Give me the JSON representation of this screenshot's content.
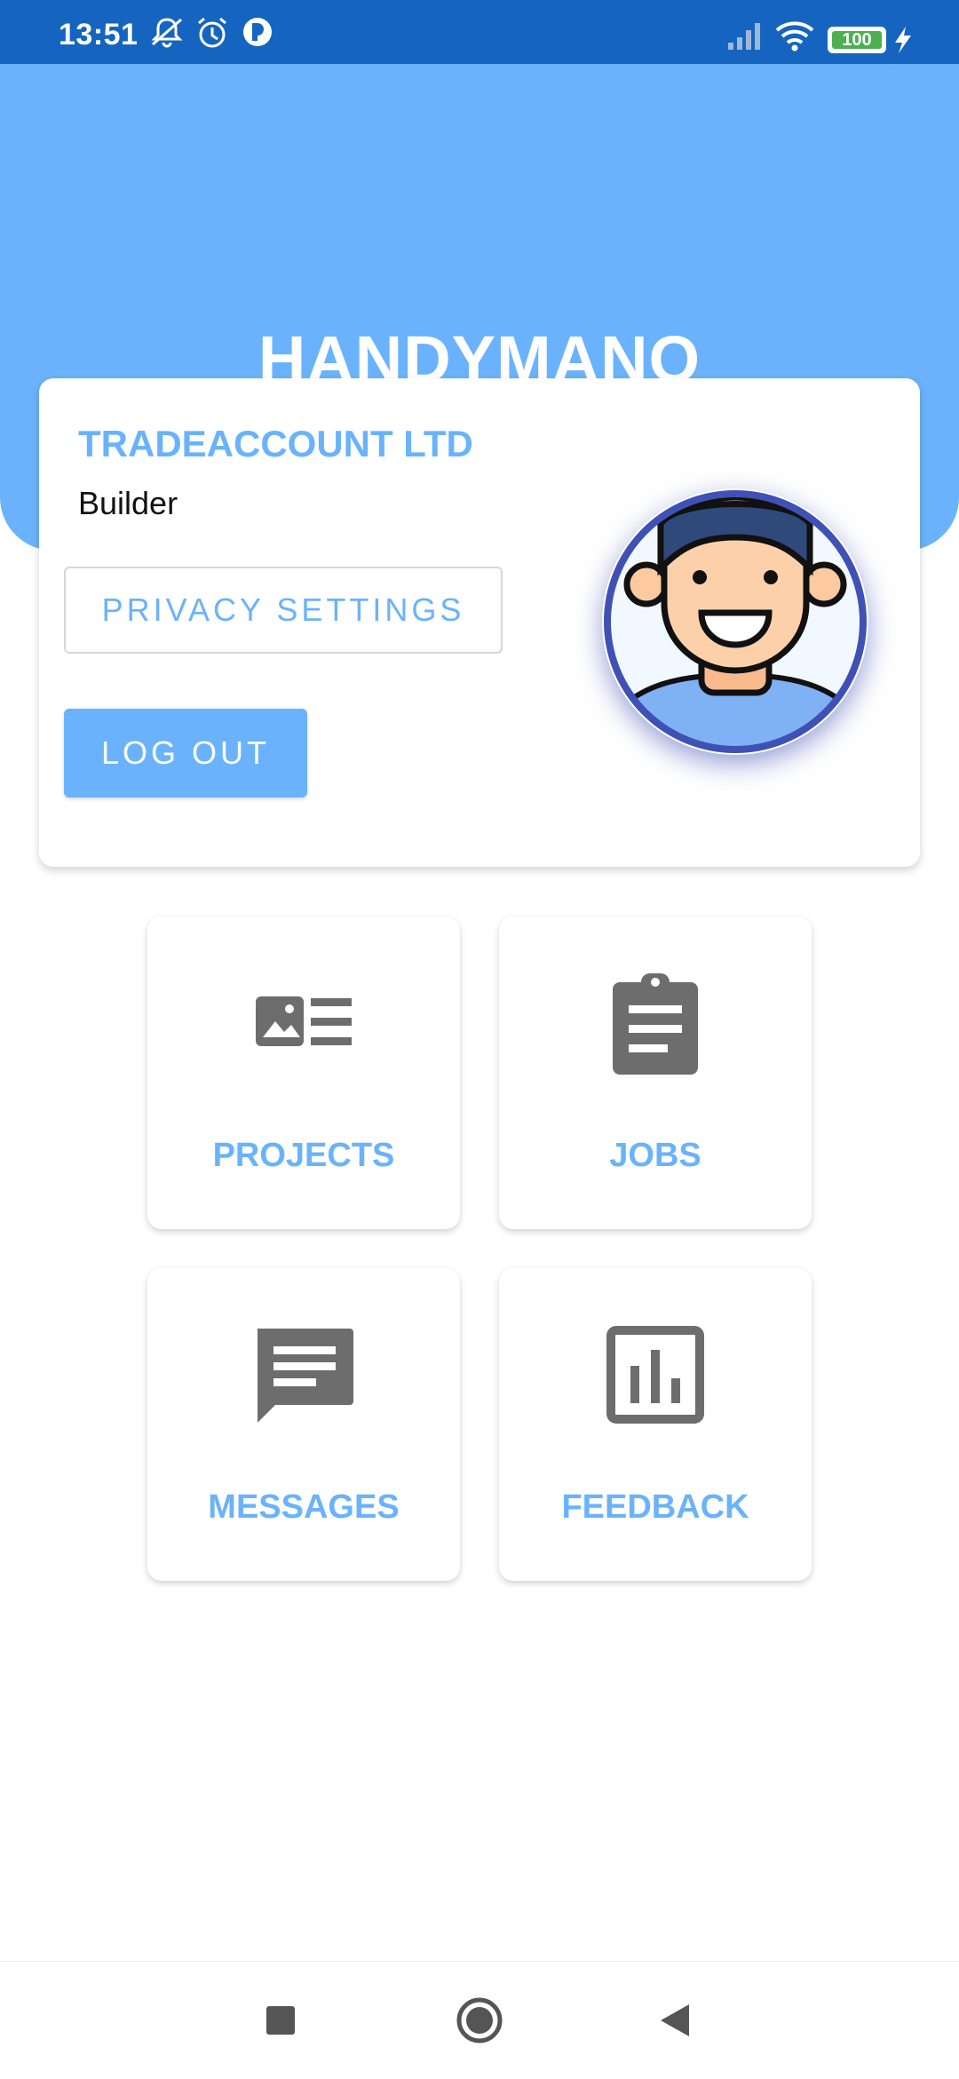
{
  "status_bar": {
    "time": "13:51",
    "battery": "100",
    "icons": [
      "notifications-off-icon",
      "alarm-icon",
      "app-icon",
      "signal-icon",
      "wifi-icon",
      "battery-icon",
      "charging-icon"
    ]
  },
  "header": {
    "title": "HANDYMANO"
  },
  "profile": {
    "company": "TRADEACCOUNT LTD",
    "role": "Builder",
    "privacy_label": "PRIVACY SETTINGS",
    "logout_label": "LOG OUT",
    "avatar_icon": "user-avatar-icon"
  },
  "tiles": [
    {
      "label": "PROJECTS",
      "icon": "projects-icon"
    },
    {
      "label": "JOBS",
      "icon": "clipboard-icon"
    },
    {
      "label": "MESSAGES",
      "icon": "message-icon"
    },
    {
      "label": "FEEDBACK",
      "icon": "bar-chart-icon"
    }
  ],
  "nav": {
    "icons": [
      "recent-apps-icon",
      "home-icon",
      "back-icon"
    ]
  },
  "colors": {
    "status_bar": "#1565c0",
    "header": "#6ab3fc",
    "accent": "#6ab3fc",
    "icon_gray": "#6d6d6d"
  }
}
